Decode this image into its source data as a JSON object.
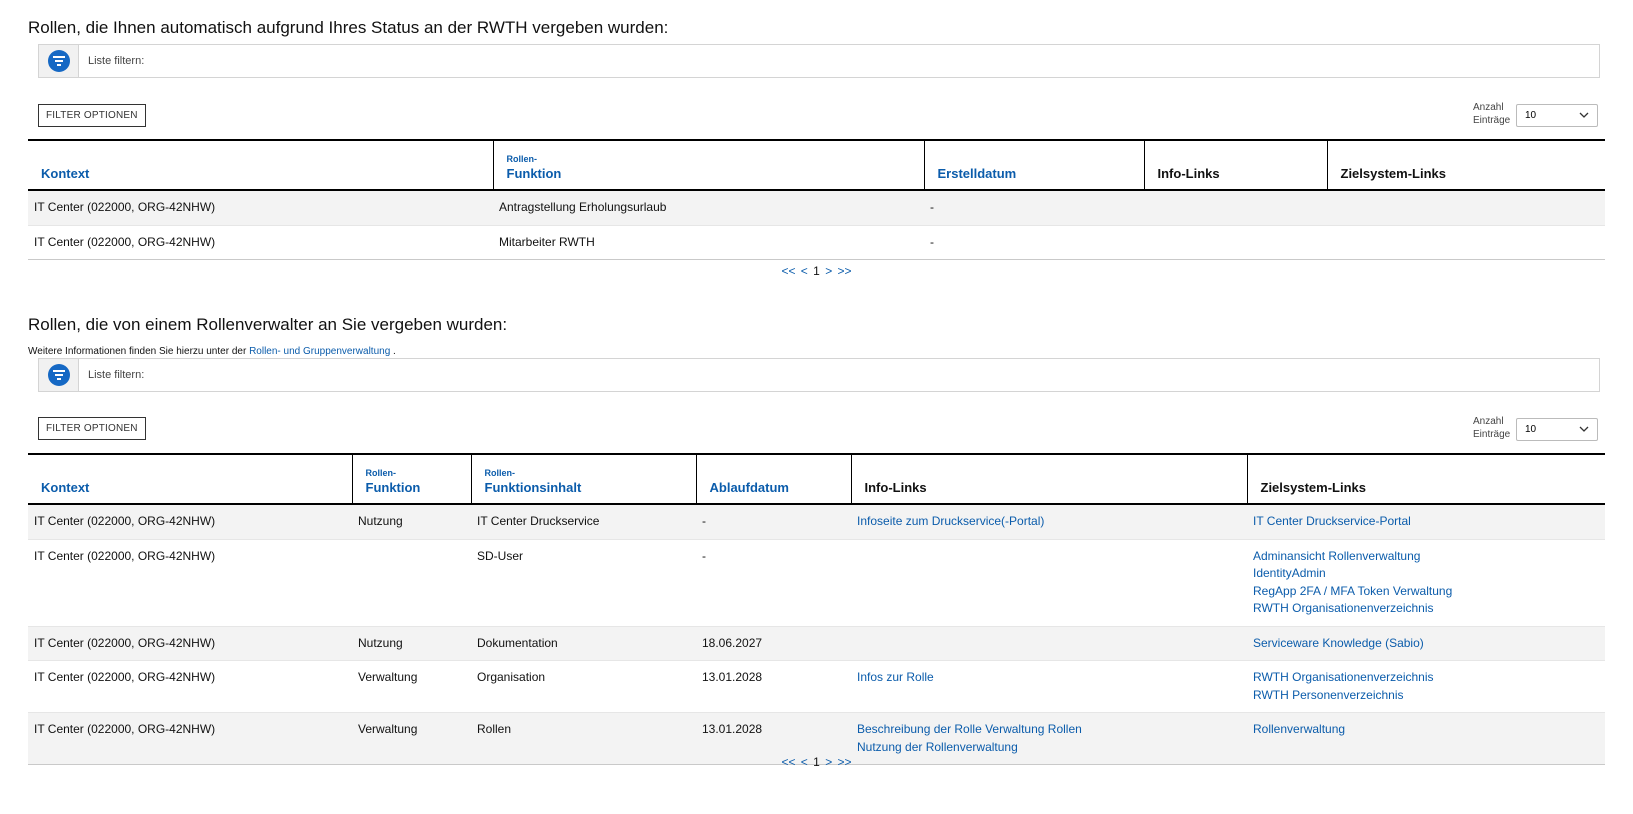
{
  "section1": {
    "title": "Rollen, die Ihnen automatisch aufgrund Ihres Status an der RWTH vergeben wurden:",
    "filter_label": "Liste filtern:",
    "filter_options_label": "FILTER OPTIONEN",
    "anzahl_line1": "Anzahl",
    "anzahl_line2": "Einträge",
    "page_size": "10",
    "columns": [
      {
        "small": "",
        "label": "Kontext"
      },
      {
        "small": "Rollen-",
        "label": "Funktion"
      },
      {
        "small": "",
        "label": "Erstelldatum"
      },
      {
        "small": "",
        "label": "Info-Links"
      },
      {
        "small": "",
        "label": "Zielsystem-Links"
      }
    ],
    "rows": [
      {
        "kontext": "IT Center (022000, ORG-42NHW)",
        "funktion": "Antragstellung Erholungsurlaub",
        "datum": "-"
      },
      {
        "kontext": "IT Center (022000, ORG-42NHW)",
        "funktion": "Mitarbeiter RWTH",
        "datum": "-"
      }
    ],
    "pager": {
      "first": "<<",
      "prev": "<",
      "current": "1",
      "next": ">",
      "last": ">>"
    }
  },
  "section2": {
    "title": "Rollen, die von einem Rollenverwalter an Sie vergeben wurden:",
    "note_text": "Weitere Informationen finden Sie hierzu unter der",
    "note_link": "Rollen- und Gruppenverwaltung",
    "note_end": ".",
    "filter_label": "Liste filtern:",
    "filter_options_label": "FILTER OPTIONEN",
    "anzahl_line1": "Anzahl",
    "anzahl_line2": "Einträge",
    "page_size": "10",
    "columns": [
      {
        "small": "",
        "label": "Kontext"
      },
      {
        "small": "Rollen-",
        "label": "Funktion"
      },
      {
        "small": "Rollen-",
        "label": "Funktionsinhalt"
      },
      {
        "small": "",
        "label": "Ablaufdatum"
      },
      {
        "small": "",
        "label": "Info-Links"
      },
      {
        "small": "",
        "label": "Zielsystem-Links"
      }
    ],
    "rows": [
      {
        "kontext": "IT Center (022000, ORG-42NHW)",
        "funktion": "Nutzung",
        "inhalt": "IT Center Druckservice",
        "datum": "-",
        "info": [
          "Infoseite zum Druckservice(-Portal)"
        ],
        "ziel": [
          "IT Center Druckservice-Portal"
        ]
      },
      {
        "kontext": "IT Center (022000, ORG-42NHW)",
        "funktion": "",
        "inhalt": "SD-User",
        "datum": "-",
        "info": [],
        "ziel": [
          "Adminansicht Rollenverwaltung",
          "IdentityAdmin",
          "RegApp 2FA / MFA Token Verwaltung",
          "RWTH Organisationenverzeichnis"
        ]
      },
      {
        "kontext": "IT Center (022000, ORG-42NHW)",
        "funktion": "Nutzung",
        "inhalt": "Dokumentation",
        "datum": "18.06.2027",
        "info": [],
        "ziel": [
          "Serviceware Knowledge (Sabio)"
        ]
      },
      {
        "kontext": "IT Center (022000, ORG-42NHW)",
        "funktion": "Verwaltung",
        "inhalt": "Organisation",
        "datum": "13.01.2028",
        "info": [
          "Infos zur Rolle"
        ],
        "ziel": [
          "RWTH Organisationenverzeichnis",
          "RWTH Personenverzeichnis"
        ]
      },
      {
        "kontext": "IT Center (022000, ORG-42NHW)",
        "funktion": "Verwaltung",
        "inhalt": "Rollen",
        "datum": "13.01.2028",
        "info": [
          "Beschreibung der Rolle Verwaltung Rollen",
          "Nutzung der Rollenverwaltung"
        ],
        "ziel": [
          "Rollenverwaltung"
        ]
      }
    ],
    "pager": {
      "first": "<<",
      "prev": "<",
      "current": "1",
      "next": ">",
      "last": ">>"
    }
  },
  "colors": {
    "link": "#0b5cab",
    "icon": "#1568c4"
  }
}
